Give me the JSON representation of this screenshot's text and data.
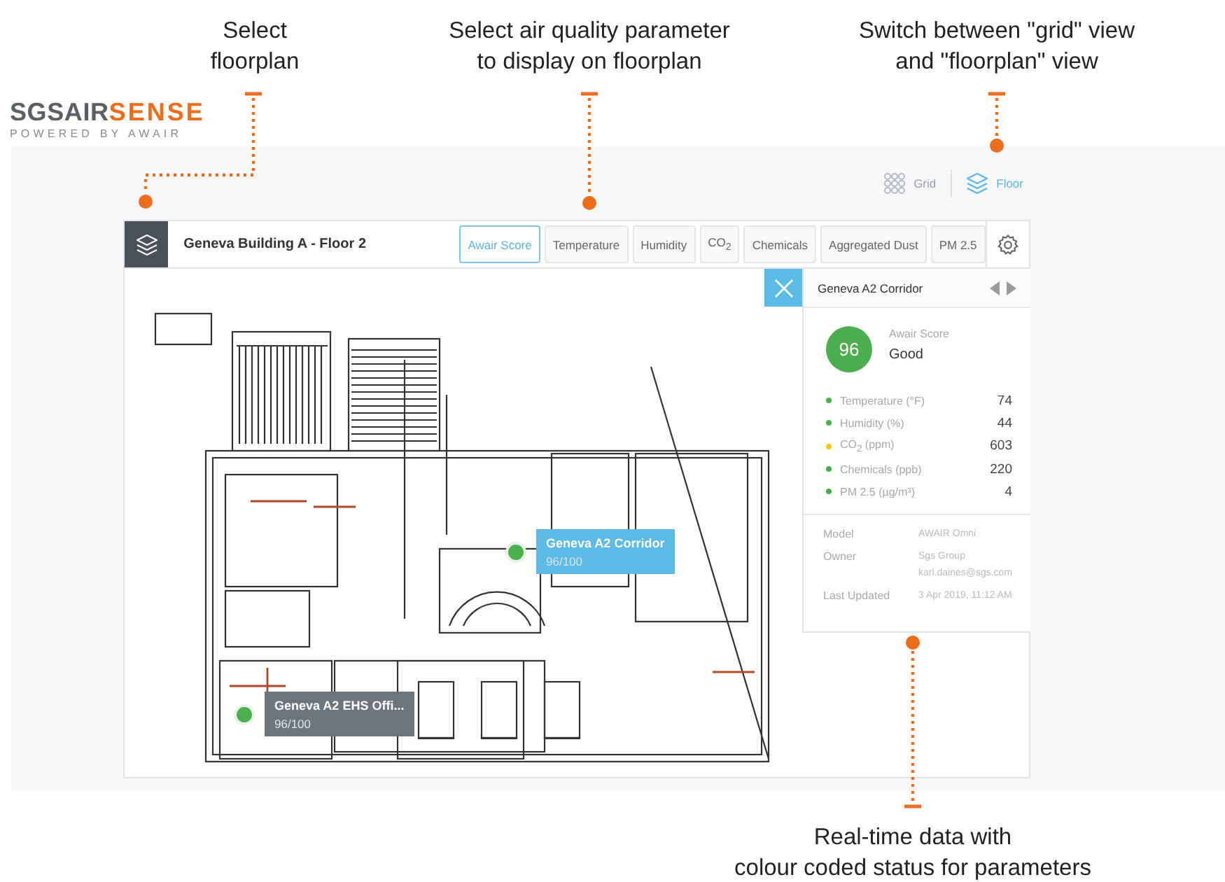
{
  "callouts": [
    {
      "lines": [
        "Select",
        "floorplan"
      ]
    },
    {
      "lines": [
        "Select air quality parameter",
        "to display on floorplan"
      ]
    },
    {
      "lines": [
        "Switch between \"grid\" view",
        "and \"floorplan\" view"
      ]
    },
    {
      "lines": [
        "Real-time data with",
        "colour coded status for parameters"
      ]
    }
  ],
  "logo": {
    "dark": "SGSAIR",
    "accent": "SENSE",
    "tagline": "POWERED BY AWAIR"
  },
  "view_toggle": [
    {
      "label": "Grid",
      "selected": false
    },
    {
      "label": "Floor",
      "selected": true
    }
  ],
  "toolbar": {
    "title": "Geneva Building A - Floor 2",
    "parameters": [
      {
        "label": "Awair Score",
        "selected": true
      },
      {
        "label": "Temperature",
        "selected": false
      },
      {
        "label": "Humidity",
        "selected": false
      },
      {
        "label": "CO$_{2}$",
        "selected": false
      },
      {
        "label": "Chemicals",
        "selected": false
      },
      {
        "label": "Aggregated Dust",
        "selected": false
      },
      {
        "label": "PM 2.5",
        "selected": false
      }
    ]
  },
  "markers": [
    {
      "name": "Geneva A2 Corridor",
      "score": "96/100",
      "selected": true,
      "color": "#4caf50"
    },
    {
      "name": "Geneva A2 EHS Offi...",
      "score": "96/100",
      "selected": false,
      "color": "#4caf50"
    }
  ],
  "side_panel": {
    "title": "Geneva A2 Corridor",
    "score": "96",
    "score_label": "Awair Score",
    "rating": "Good",
    "readings": [
      {
        "name": "Temperature (°F)",
        "value": "74",
        "color": "#4caf50"
      },
      {
        "name": "Humidity (%)",
        "value": "44",
        "color": "#4caf50"
      },
      {
        "name": "CO$_{2}$ (ppm)",
        "value": "603",
        "color": "#f5c518"
      },
      {
        "name": "Chemicals (ppb)",
        "value": "220",
        "color": "#4caf50"
      },
      {
        "name": "PM 2.5 (µg/m³)",
        "value": "4",
        "color": "#4caf50"
      }
    ],
    "info": [
      {
        "label": "Model",
        "values": [
          "AWAIR Omni"
        ]
      },
      {
        "label": "Owner",
        "values": [
          "Sgs Group",
          "karl.daines@sgs.com"
        ]
      },
      {
        "label": "Last Updated",
        "values": [
          "3 Apr 2019, 11:12 AM"
        ]
      }
    ]
  }
}
